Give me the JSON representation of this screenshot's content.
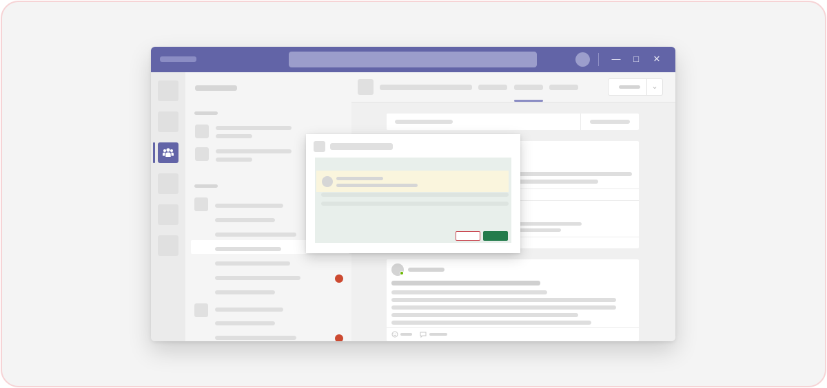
{
  "window": {
    "title_text": "",
    "search_placeholder": "",
    "controls": {
      "minimize": "—",
      "maximize": "□",
      "close": "✕"
    }
  },
  "rail": {
    "items": [
      {
        "icon": "placeholder-icon",
        "active": false
      },
      {
        "icon": "placeholder-icon",
        "active": false
      },
      {
        "icon": "teams-icon",
        "active": true
      },
      {
        "icon": "placeholder-icon",
        "active": false
      },
      {
        "icon": "placeholder-icon",
        "active": false
      },
      {
        "icon": "placeholder-icon",
        "active": false
      }
    ]
  },
  "main": {
    "dropdown_chevron": "⌄"
  },
  "dialog": {
    "primary_button_label": "",
    "secondary_button_label": ""
  },
  "colors": {
    "brand": "#6264a7",
    "accent_green": "#237b4b",
    "alert_red": "#cc4a31",
    "outline_red": "#c94b54",
    "highlight_yellow": "#faf5dd",
    "presence_green": "#6bb700"
  }
}
